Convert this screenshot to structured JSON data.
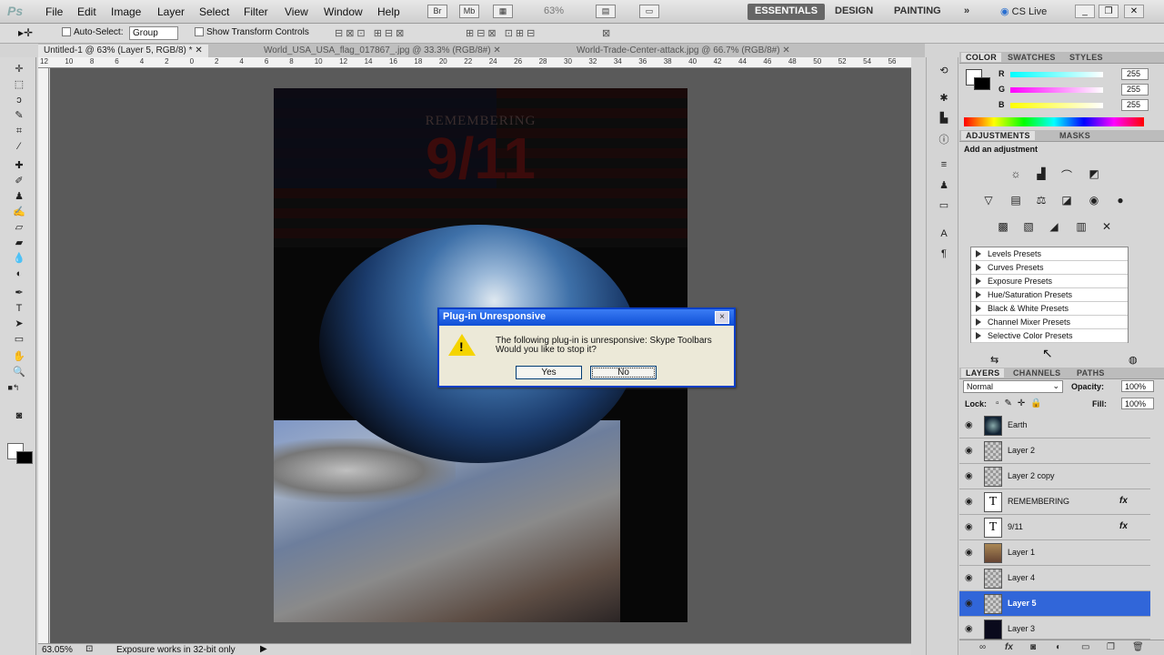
{
  "menubar": {
    "logo": "Ps",
    "menus": [
      "File",
      "Edit",
      "Image",
      "Layer",
      "Select",
      "Filter",
      "View",
      "Window",
      "Help"
    ],
    "icons": [
      "Br",
      "Mb"
    ],
    "zoom": "63%",
    "workspaces": [
      "ESSENTIALS",
      "DESIGN",
      "PAINTING"
    ],
    "more": "»",
    "cs_live": "CS Live",
    "cs_live_icon": "cs-live-icon"
  },
  "options": {
    "auto_select_label": "Auto-Select:",
    "auto_select_value": "Group",
    "show_transform_label": "Show Transform Controls"
  },
  "tabs": [
    {
      "label": "Untitled-1 @ 63% (Layer 5, RGB/8) *"
    },
    {
      "label": "World_USA_USA_flag_017867_.jpg @ 33.3% (RGB/8#)"
    },
    {
      "label": "World-Trade-Center-attack.jpg @ 66.7% (RGB/8#)"
    }
  ],
  "ruler_ticks": [
    "12",
    "10",
    "8",
    "6",
    "4",
    "2",
    "0",
    "2",
    "4",
    "6",
    "8",
    "10",
    "12",
    "14",
    "16",
    "18",
    "20",
    "22",
    "24",
    "26",
    "28",
    "30",
    "32",
    "34",
    "36",
    "38",
    "40",
    "42",
    "44",
    "46",
    "48",
    "50",
    "52",
    "54",
    "56"
  ],
  "document": {
    "remembering": "REMEMBERING",
    "title": "9/11"
  },
  "dialog": {
    "title": "Plug-in Unresponsive",
    "close": "×",
    "warning": "!",
    "message_line1": "The following plug-in is unresponsive: Skype Toolbars",
    "message_line2": "Would you like to stop it?",
    "yes": "Yes",
    "no": "No"
  },
  "status": {
    "zoom": "63.05%",
    "message": "Exposure works in 32-bit only"
  },
  "color_panel": {
    "tabs": [
      "COLOR",
      "SWATCHES",
      "STYLES"
    ],
    "channels": [
      {
        "label": "R",
        "value": "255",
        "color": "#ff0000"
      },
      {
        "label": "G",
        "value": "255",
        "color": "#00ff00"
      },
      {
        "label": "B",
        "value": "255",
        "color": "#0000ff"
      }
    ]
  },
  "adjustments_panel": {
    "tabs": [
      "ADJUSTMENTS",
      "MASKS"
    ],
    "heading": "Add an adjustment",
    "presets": [
      "Levels Presets",
      "Curves Presets",
      "Exposure Presets",
      "Hue/Saturation Presets",
      "Black & White Presets",
      "Channel Mixer Presets",
      "Selective Color Presets"
    ]
  },
  "layers_panel": {
    "tabs": [
      "LAYERS",
      "CHANNELS",
      "PATHS"
    ],
    "blend_mode": "Normal",
    "opacity_label": "Opacity:",
    "opacity": "100%",
    "lock_label": "Lock:",
    "fill_label": "Fill:",
    "fill": "100%",
    "layers": [
      {
        "name": "Earth",
        "kind": "earth",
        "fx": ""
      },
      {
        "name": "Layer 2",
        "kind": "pixel",
        "fx": ""
      },
      {
        "name": "Layer 2 copy",
        "kind": "pixel",
        "fx": ""
      },
      {
        "name": "REMEMBERING",
        "kind": "text",
        "fx": "fx"
      },
      {
        "name": "9/11",
        "kind": "text",
        "fx": "fx"
      },
      {
        "name": "Layer 1",
        "kind": "photo",
        "fx": ""
      },
      {
        "name": "Layer 4",
        "kind": "pixel",
        "fx": ""
      },
      {
        "name": "Layer 5",
        "kind": "pixel",
        "fx": "",
        "selected": true
      },
      {
        "name": "Layer 3",
        "kind": "dark",
        "fx": ""
      }
    ],
    "text_thumb": "T"
  }
}
